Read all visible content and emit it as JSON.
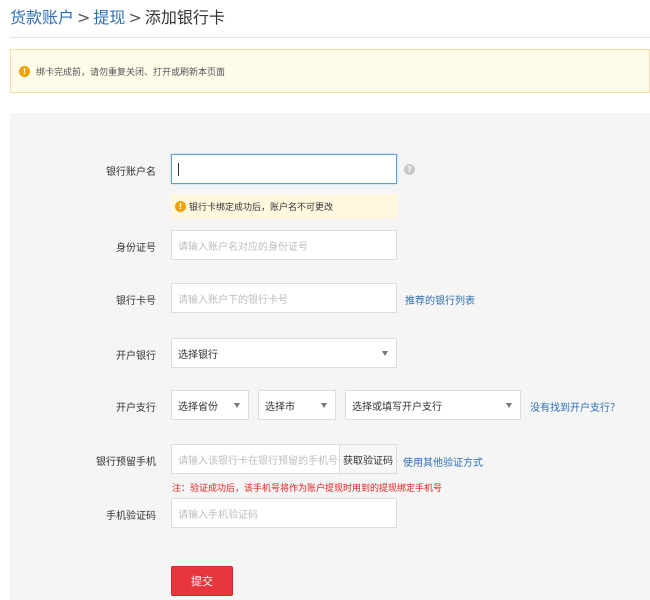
{
  "breadcrumb": {
    "item1": "货款账户",
    "sep1": ">",
    "item2": "提现",
    "sep2": ">",
    "current": "添加银行卡"
  },
  "notice": {
    "icon": "warning-icon",
    "text": "绑卡完成前，请勿重复关闭、打开或刷新本页面"
  },
  "form": {
    "account_name": {
      "label": "银行账户名",
      "value": "",
      "tip": "银行卡绑定成功后，账户名不可更改",
      "help_icon": "question-icon"
    },
    "id_number": {
      "label": "身份证号",
      "placeholder": "请输入账户名对应的身份证号"
    },
    "card_number": {
      "label": "银行卡号",
      "placeholder": "请输入账户下的银行卡号",
      "link": "推荐的银行列表"
    },
    "bank": {
      "label": "开户银行",
      "selected": "选择银行"
    },
    "branch": {
      "label": "开户支行",
      "province": "选择省份",
      "city": "选择市",
      "branch": "选择或填写开户支行",
      "link": "没有找到开户支行？"
    },
    "phone": {
      "label": "银行预留手机",
      "placeholder": "请输入该银行卡在银行预留的手机号码",
      "code_button": "获取验证码",
      "alt_link": "使用其他验证方式",
      "note": "注：验证成功后，该手机号将作为账户提现时用到的提现绑定手机号"
    },
    "sms_code": {
      "label": "手机验证码",
      "placeholder": "请输入手机验证码"
    },
    "submit_label": "提交"
  },
  "colors": {
    "link": "#2f6fb5",
    "submit": "#e8373c",
    "warning": "#f0a000",
    "note_red": "#e02020",
    "focus_border": "#5b9fe0"
  }
}
